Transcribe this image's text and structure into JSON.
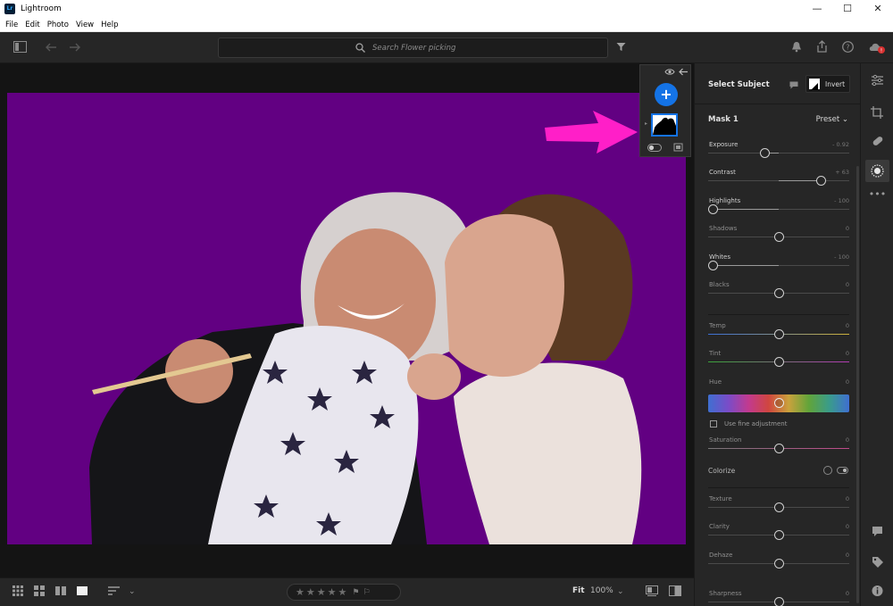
{
  "window": {
    "app_icon_text": "Lr",
    "title": "Lightroom",
    "minimize": "—",
    "maximize": "☐",
    "close": "✕"
  },
  "menu": [
    "File",
    "Edit",
    "Photo",
    "View",
    "Help"
  ],
  "search": {
    "placeholder": "Search Flower picking"
  },
  "mask_panel": {
    "add_label": "+",
    "eye_icon": "eye-icon",
    "back_icon": "arrow-left-icon"
  },
  "right_panel": {
    "header_title": "Select Subject",
    "invert_label": "Invert",
    "mask_name": "Mask 1",
    "preset_label": "Preset",
    "sliders": [
      {
        "name": "Exposure",
        "value": "- 0.92",
        "pos": 0.4,
        "active": true
      },
      {
        "name": "Contrast",
        "value": "+ 63",
        "pos": 0.8,
        "active": true
      },
      {
        "name": "Highlights",
        "value": "- 100",
        "pos": 0.03,
        "active": true
      },
      {
        "name": "Shadows",
        "value": "0",
        "pos": 0.5,
        "active": false
      },
      {
        "name": "Whites",
        "value": "- 100",
        "pos": 0.03,
        "active": true
      },
      {
        "name": "Blacks",
        "value": "0",
        "pos": 0.5,
        "active": false
      },
      {
        "name": "Temp",
        "value": "0",
        "pos": 0.5,
        "active": false
      },
      {
        "name": "Tint",
        "value": "0",
        "pos": 0.5,
        "active": false
      },
      {
        "name": "Hue",
        "value": "0",
        "pos": 0.5,
        "active": false
      },
      {
        "name": "Saturation",
        "value": "0",
        "pos": 0.5,
        "active": false
      },
      {
        "name": "Texture",
        "value": "0",
        "pos": 0.5,
        "active": false
      },
      {
        "name": "Clarity",
        "value": "0",
        "pos": 0.5,
        "active": false
      },
      {
        "name": "Dehaze",
        "value": "0",
        "pos": 0.5,
        "active": false
      },
      {
        "name": "Sharpness",
        "value": "0",
        "pos": 0.5,
        "active": false
      }
    ],
    "fine_adjustment_label": "Use fine adjustment",
    "colorize_label": "Colorize"
  },
  "bottom_bar": {
    "fit_label": "Fit",
    "zoom_label": "100%",
    "stars": [
      "★",
      "★",
      "★",
      "★",
      "★"
    ],
    "flags": [
      "⚑",
      "⚐"
    ]
  },
  "colors": {
    "accent": "#1473e6",
    "mask_overlay": "#620082",
    "annotation_arrow": "#ff1fc8"
  }
}
